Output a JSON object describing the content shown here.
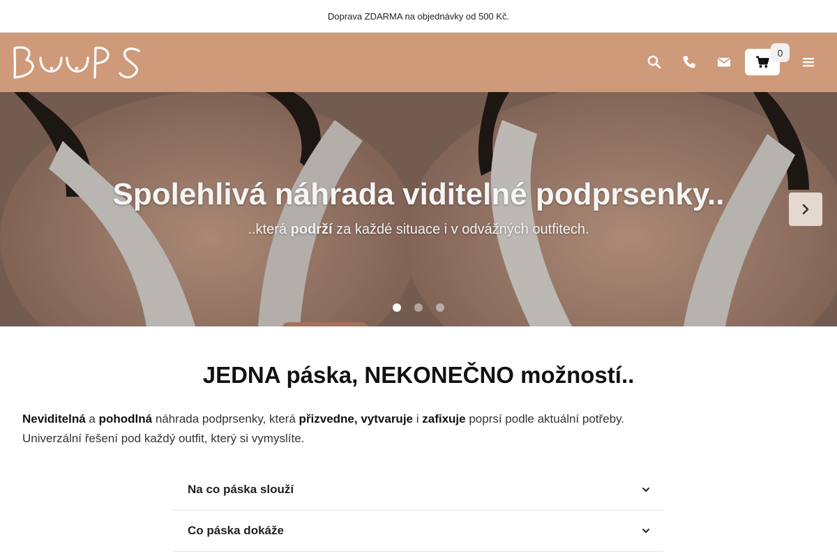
{
  "announcement": "Doprava ZDARMA na objednávky od 500 Kč.",
  "brand": {
    "logo_text": "BOOPS",
    "header_color": "#cf9a7a"
  },
  "header": {
    "icons": [
      "search-icon",
      "phone-icon",
      "envelope-icon",
      "cart-icon",
      "menu-icon"
    ],
    "cart_count": "0"
  },
  "hero": {
    "title": "Spolehlivá náhrada viditelné podprsenky..",
    "subtitle_pre": "..která ",
    "subtitle_bold": "podrží",
    "subtitle_post": " za každé situace i v odvážných outfitech.",
    "slides_count": 3,
    "active_slide": 1
  },
  "main": {
    "heading": "JEDNA páska, NEKONEČNO možností..",
    "intro": {
      "p1": "Neviditelná",
      "p2": " a ",
      "p3": "pohodlná",
      "p4": " náhrada podprsenky, která ",
      "p5": "přizvedne, vytvaruje",
      "p6": " i ",
      "p7": "zafixuje",
      "p8": " poprsí podle aktuální potřeby.",
      "line2": "Univerzální řešení pod každý outfit, který si vymyslíte."
    },
    "accordion": [
      {
        "label": "Na co páska slouží"
      },
      {
        "label": "Co páska dokáže"
      }
    ]
  }
}
